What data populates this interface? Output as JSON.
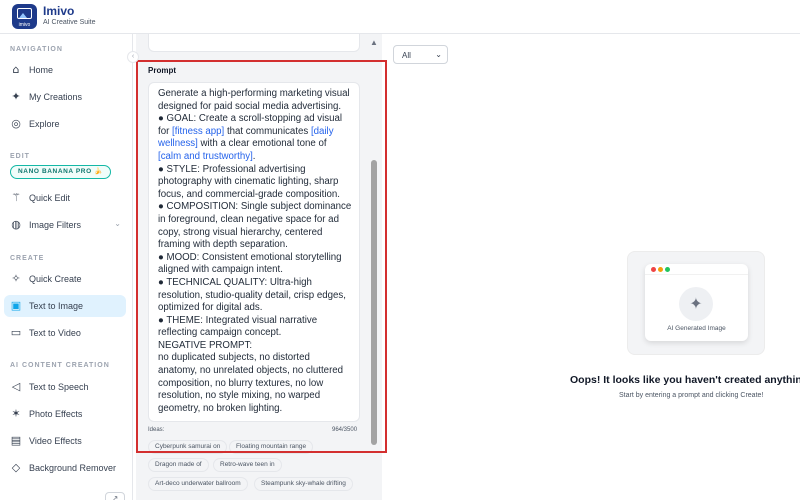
{
  "app": {
    "name": "Imivo",
    "subtitle": "AI Creative Suite",
    "logo_text": "imivo"
  },
  "sidebar": {
    "sections": {
      "navigation": "NAVIGATION",
      "edit": "EDIT",
      "create": "CREATE",
      "ai_content": "AI CONTENT CREATION"
    },
    "badge": "NANO BANANA PRO 🍌",
    "items": [
      {
        "label": "Home",
        "icon": "home-icon"
      },
      {
        "label": "My Creations",
        "icon": "sparkles-icon"
      },
      {
        "label": "Explore",
        "icon": "compass-icon"
      },
      {
        "label": "Quick Edit",
        "icon": "magic-wand-icon"
      },
      {
        "label": "Image Filters",
        "icon": "palette-icon"
      },
      {
        "label": "Quick Create",
        "icon": "sparkles-icon"
      },
      {
        "label": "Text to Image",
        "icon": "image-edit-icon",
        "active": true
      },
      {
        "label": "Text to Video",
        "icon": "video-icon"
      },
      {
        "label": "Text to Speech",
        "icon": "speaker-icon"
      },
      {
        "label": "Photo Effects",
        "icon": "star-icon"
      },
      {
        "label": "Video Effects",
        "icon": "film-icon"
      },
      {
        "label": "Background Remover",
        "icon": "eraser-icon"
      }
    ]
  },
  "prompt": {
    "label": "Prompt",
    "lines": [
      [
        {
          "t": "Generate a high-performing marketing visual"
        }
      ],
      [
        {
          "t": "designed for paid social media advertising."
        }
      ],
      [
        {
          "t": "●  GOAL: Create a scroll-stopping ad visual"
        }
      ],
      [
        {
          "t": "for "
        },
        {
          "t": "[fitness app]",
          "hl": true
        },
        {
          "t": " that communicates "
        },
        {
          "t": "[daily",
          "hl": true
        }
      ],
      [
        {
          "t": "wellness]",
          "hl": true
        },
        {
          "t": " with a clear emotional tone of"
        }
      ],
      [
        {
          "t": "[calm and trustworthy]",
          "hl": true
        },
        {
          "t": "."
        }
      ],
      [
        {
          "t": "●  STYLE: Professional advertising"
        }
      ],
      [
        {
          "t": "photography with cinematic lighting, sharp"
        }
      ],
      [
        {
          "t": "focus, and commercial-grade composition."
        }
      ],
      [
        {
          "t": "●  COMPOSITION: Single subject dominance"
        }
      ],
      [
        {
          "t": "in foreground, clean negative space for ad"
        }
      ],
      [
        {
          "t": "copy, strong visual hierarchy, centered"
        }
      ],
      [
        {
          "t": "framing with depth separation."
        }
      ],
      [
        {
          "t": "●  MOOD: Consistent emotional storytelling"
        }
      ],
      [
        {
          "t": "aligned with campaign intent."
        }
      ],
      [
        {
          "t": "●  TECHNICAL QUALITY: Ultra-high"
        }
      ],
      [
        {
          "t": "resolution, studio-quality detail, crisp edges,"
        }
      ],
      [
        {
          "t": "optimized for digital ads."
        }
      ],
      [
        {
          "t": "●  THEME: Integrated visual narrative"
        }
      ],
      [
        {
          "t": "reflecting campaign concept."
        }
      ],
      [
        {
          "t": "NEGATIVE PROMPT:"
        }
      ],
      [
        {
          "t": " no duplicated subjects, no distorted"
        }
      ],
      [
        {
          "t": "anatomy, no unrelated objects, no cluttered"
        }
      ],
      [
        {
          "t": "composition, no blurry textures, no low"
        }
      ],
      [
        {
          "t": "resolution, no style mixing, no warped"
        }
      ],
      [
        {
          "t": "geometry, no broken lighting."
        }
      ]
    ],
    "ideas_label": "Ideas:",
    "counter": "964/3500",
    "ideas": [
      "Cyberpunk samurai on",
      "Floating mountain range",
      "Dragon made of",
      "Retro-wave teen in",
      "Art-deco underwater ballroom",
      "Steampunk sky-whale drifting"
    ]
  },
  "gallery": {
    "filter_value": "All",
    "empty_caption": "AI Generated Image",
    "empty_title": "Oops! It looks like you haven't created anything",
    "empty_subtitle": "Start by entering a prompt and clicking Create!"
  },
  "colors": {
    "accent": "#0ea5e9",
    "brand": "#1e3a8a",
    "highlight_text": "#2563eb",
    "annotation_frame": "#d32f2f"
  }
}
